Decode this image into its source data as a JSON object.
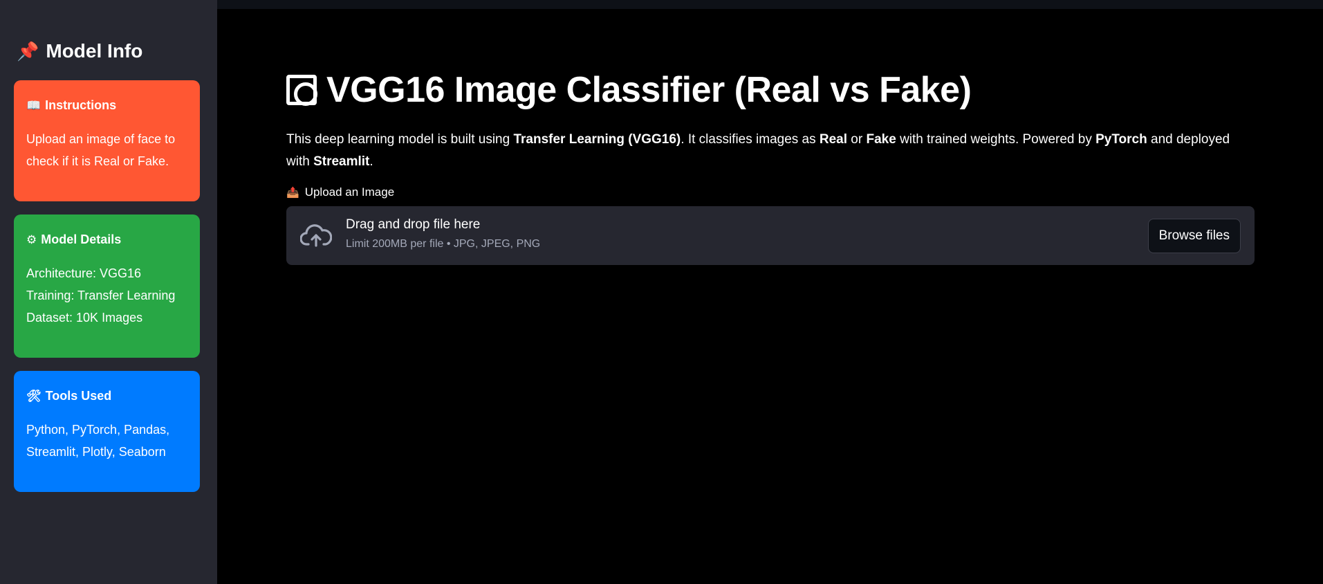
{
  "sidebar": {
    "title": "Model Info",
    "title_icon": "pushpin-icon",
    "cards": {
      "instructions": {
        "icon": "📖",
        "heading": "Instructions",
        "lines": [
          "Upload an image of face to",
          "check if it is Real or Fake."
        ],
        "color": "#ff5733"
      },
      "details": {
        "icon": "⚙",
        "heading": "Model Details",
        "lines": [
          "Architecture: VGG16",
          "Training: Transfer Learning",
          "Dataset: 10K Images"
        ],
        "color": "#28a745"
      },
      "tools": {
        "icon": "🛠",
        "heading": "Tools Used",
        "lines": [
          "Python, PyTorch, Pandas,",
          "Streamlit, Plotly, Seaborn"
        ],
        "color": "#007bff"
      }
    }
  },
  "main": {
    "title": "VGG16 Image Classifier (Real vs Fake)",
    "description": {
      "p1": "This deep learning model is built using ",
      "b1": "Transfer Learning (VGG16)",
      "p2": ". It classifies images as ",
      "b2": "Real",
      "p3": " or ",
      "b3": "Fake",
      "p4": " with trained weights. Powered by ",
      "b4": "PyTorch",
      "p5": " and deployed with ",
      "b5": "Streamlit",
      "p6": "."
    },
    "uploader": {
      "label": "Upload an Image",
      "label_icon": "📤",
      "drag_text": "Drag and drop file here",
      "limit_text": "Limit 200MB per file • JPG, JPEG, PNG",
      "browse_label": "Browse files"
    }
  },
  "colors": {
    "sidebar_bg": "#262730",
    "main_bg": "#000000",
    "dropzone_bg": "#262730"
  }
}
